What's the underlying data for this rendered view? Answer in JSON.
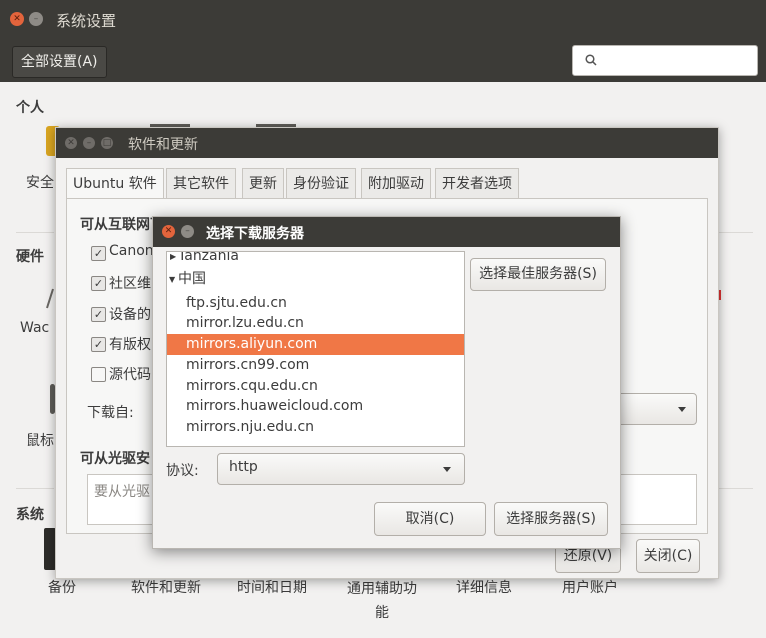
{
  "main_window": {
    "title": "系统设置",
    "toolbar": {
      "all_settings_label": "全部设置(A)",
      "search_placeholder": ""
    },
    "sections": {
      "personal": {
        "label": "个人",
        "items": [
          "安全"
        ]
      },
      "hardware": {
        "label": "硬件",
        "items": [
          "Wac",
          "鼠标"
        ]
      },
      "system": {
        "label": "系统",
        "items": [
          "备份",
          "软件和更新",
          "时间和日期",
          "通用辅助功\n能",
          "详细信息",
          "用户账户"
        ]
      }
    }
  },
  "software_updates": {
    "title": "软件和更新",
    "tabs": [
      "Ubuntu 软件",
      "其它软件",
      "更新",
      "身份验证",
      "附加驱动",
      "开发者选项"
    ],
    "internet_section_label": "可从互联网下载",
    "checkboxes": [
      {
        "label": "Canon",
        "checked": true
      },
      {
        "label": "社区维",
        "checked": true
      },
      {
        "label": "设备的",
        "checked": true
      },
      {
        "label": "有版权",
        "checked": true
      },
      {
        "label": "源代码",
        "checked": false
      }
    ],
    "download_from_label": "下载自:",
    "cdrom_section_label": "可从光驱安",
    "cdrom_placeholder": "要从光驱",
    "revert_button": "还原(V)",
    "close_button": "关闭(C)"
  },
  "server_dialog": {
    "title": "选择下载服务器",
    "list": [
      {
        "text": "Tanzania",
        "type": "country",
        "expanded": false
      },
      {
        "text": "中国",
        "type": "country",
        "expanded": true
      },
      {
        "text": "ftp.sjtu.edu.cn",
        "type": "server"
      },
      {
        "text": "mirror.lzu.edu.cn",
        "type": "server"
      },
      {
        "text": "mirrors.aliyun.com",
        "type": "server",
        "selected": true
      },
      {
        "text": "mirrors.cn99.com",
        "type": "server"
      },
      {
        "text": "mirrors.cqu.edu.cn",
        "type": "server"
      },
      {
        "text": "mirrors.huaweicloud.com",
        "type": "server"
      },
      {
        "text": "mirrors.nju.edu.cn",
        "type": "server"
      }
    ],
    "best_server_button": "选择最佳服务器(S)",
    "protocol_label": "协议:",
    "protocol_value": "http",
    "cancel_button": "取消(C)",
    "choose_button": "选择服务器(S)"
  },
  "colors": {
    "titlebar": "#3c3b37",
    "accent_orange": "#f07746",
    "close_button": "#e3643c"
  }
}
